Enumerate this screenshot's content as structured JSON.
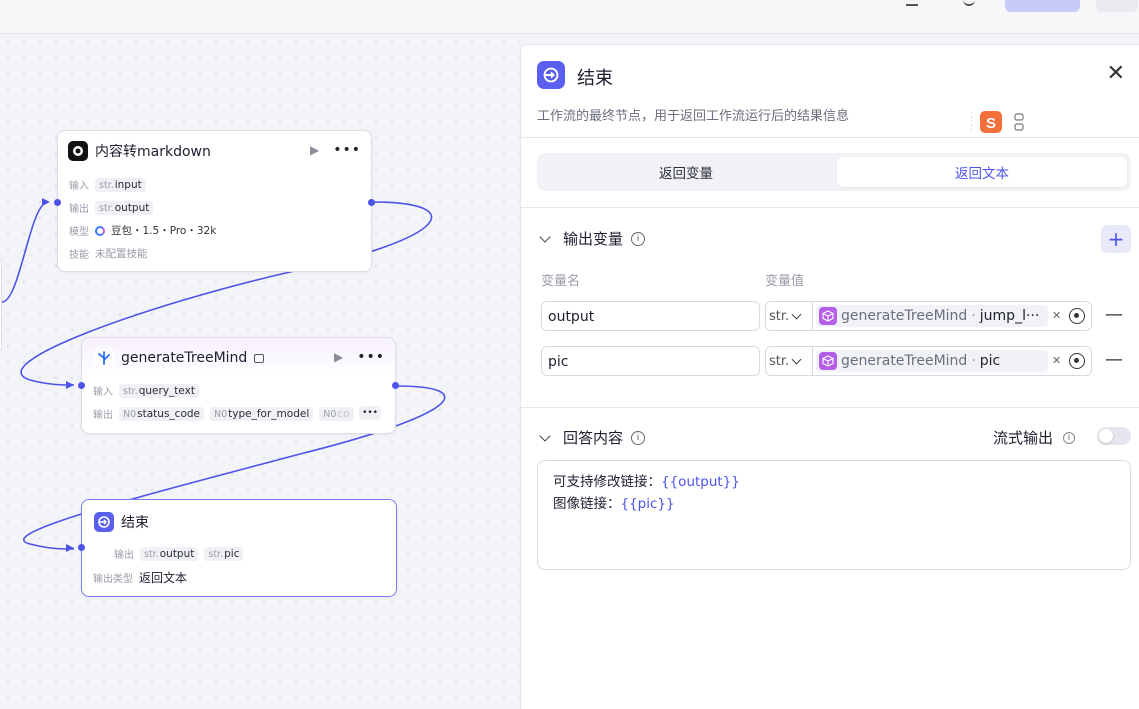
{
  "canvas": {
    "nodes": {
      "llm": {
        "title": "内容转markdown",
        "input_label": "输入",
        "input_type": "str.",
        "input_name": "input",
        "output_label": "输出",
        "output_type": "str.",
        "output_name": "output",
        "model_label": "模型",
        "model_value": "豆包・1.5・Pro・32k",
        "skill_label": "技能",
        "skill_value": "未配置技能"
      },
      "plugin": {
        "title": "generateTreeMind",
        "input_label": "输入",
        "input_type": "str.",
        "input_name": "query_text",
        "output_label": "输出",
        "outputs": [
          {
            "type": "N0",
            "name": "status_code"
          },
          {
            "type": "N0",
            "name": "type_for_model"
          },
          {
            "type": "N0",
            "name": "co"
          }
        ]
      },
      "end": {
        "title": "结束",
        "output_label": "输出",
        "outputs": [
          {
            "type": "str.",
            "name": "output"
          },
          {
            "type": "str.",
            "name": "pic"
          }
        ],
        "output_type_label": "输出类型",
        "output_type_value": "返回文本"
      }
    }
  },
  "panel": {
    "title": "结束",
    "description": "工作流的最终节点，用于返回工作流运行后的结果信息",
    "tabs": [
      {
        "label": "返回变量",
        "active": false
      },
      {
        "label": "返回文本",
        "active": true
      }
    ],
    "output_section": {
      "title": "输出变量",
      "col_name": "变量名",
      "col_value": "变量值",
      "rows": [
        {
          "name": "output",
          "type": "str.",
          "ref_node": "generateTreeMind",
          "sep": "·",
          "ref_var": "jump_l···"
        },
        {
          "name": "pic",
          "type": "str.",
          "ref_node": "generateTreeMind",
          "sep": "·",
          "ref_var": "pic"
        }
      ]
    },
    "answer_section": {
      "title": "回答内容",
      "stream_label": "流式输出",
      "stream_enabled": false,
      "line1_text": "可支持修改链接：",
      "line1_var": "{{output}}",
      "line2_text": "图像链接：",
      "line2_var": "{{pic}}"
    }
  },
  "colors": {
    "accent": "#4d53e8",
    "end_icon": "#5b5ff0",
    "plugin_icon": "#b45ee8"
  }
}
